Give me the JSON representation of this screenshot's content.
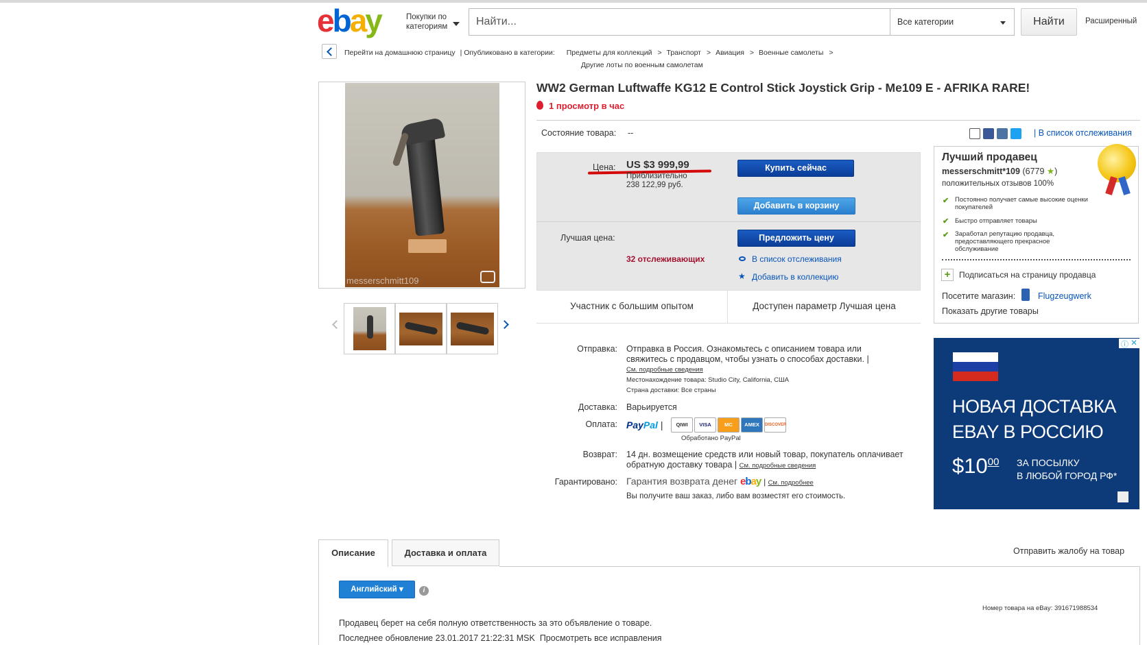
{
  "header": {
    "logo": "ebay",
    "categories_btn": "Покупки по категориям",
    "search_placeholder": "Найти...",
    "category_select": "Все категории",
    "search_button": "Найти",
    "advanced": "Расширенный"
  },
  "breadcrumb": {
    "home": "Перейти на домашнюю страницу",
    "published": "| Опубликовано в категории:",
    "items": [
      "Предметы для коллекций",
      "Транспорт",
      "Авиация",
      "Военные самолеты"
    ],
    "other": "Другие лоты по военным самолетам"
  },
  "gallery": {
    "watermark": "messerschmitt109"
  },
  "item": {
    "title": "WW2 German Luftwaffe KG12 E Control Stick Joystick Grip - Me109 E - AFRIKA RARE!",
    "views": "1 просмотр в час",
    "condition_label": "Состояние товара:",
    "condition_value": "--",
    "watchlist_top": "| В список отслеживания"
  },
  "price_box": {
    "price_label": "Цена:",
    "price": "US $3 999,99",
    "approx_line1": "Приблизительно",
    "approx_line2": "238 122,99 руб.",
    "buy_now": "Купить сейчас",
    "add_to_cart": "Добавить в корзину",
    "best_offer_label": "Лучшая цена:",
    "make_offer": "Предложить цену",
    "watchers": "32 отслеживающих",
    "add_watch": "В список отслеживания",
    "add_collection": "Добавить в коллекцию",
    "experienced": "Участник с большим опытом",
    "best_offer_available": "Доступен параметр Лучшая цена"
  },
  "seller": {
    "title": "Лучший продавец",
    "name": "messerschmitt*109",
    "feedback": "(6779",
    "feedback_end": ")",
    "positive": "положительных отзывов 100%",
    "features": [
      "Постоянно получает самые высокие оценки покупателей",
      "Быстро отправляет товары",
      "Заработал репутацию продавца, предоставляющего прекрасное обслуживание"
    ],
    "follow": "Подписаться на страницу продавца",
    "visit_label": "Посетите магазин:",
    "store": "Flugzeugwerk",
    "other_items": "Показать другие товары"
  },
  "shipping": {
    "ship_label": "Отправка:",
    "ship_text_1": "Отправка в Россия. Ознакомьтесь с описанием товара или",
    "ship_text_2": "свяжитесь с продавцом, чтобы узнать о способах доставки. |",
    "details_link": "См. подробные сведения",
    "location": "Местонахождение товара:  Studio City, California, США",
    "countries": "Страна доставки:  Все страны",
    "delivery_label": "Доставка:",
    "delivery_value": "Варьируется",
    "payment_label": "Оплата:",
    "paypal_a": "Pay",
    "paypal_b": "Pal",
    "processed": "Обработано PayPal",
    "cards": [
      "QIWI",
      "VISA",
      "MC",
      "AMEX",
      "DISCOVER"
    ],
    "returns_label": "Возврат:",
    "returns_1": "14 дн. возмещение средств или новый товар, покупатель оплачивает",
    "returns_2": "обратную доставку товара |",
    "returns_link": "См. подробные сведения",
    "guarantee_label": "Гарантировано:",
    "guarantee_text": "Гарантия возврата денег",
    "guarantee_link": "См. подробнее",
    "guarantee_note": "Вы получите ваш заказ, либо вам возместят его стоимость."
  },
  "ad": {
    "line1": "НОВАЯ ДОСТАВКА",
    "line2": "EBAY В РОССИЮ",
    "price": "$10",
    "cents": "00",
    "sub1": "ЗА ПОСЫЛКУ",
    "sub2": "В ЛЮБОЙ ГОРОД РФ*"
  },
  "tabs": {
    "description": "Описание",
    "shipping": "Доставка и оплата",
    "report": "Отправить жалобу на товар",
    "language": "Английский",
    "item_number": "Номер товара на eBay:  391671988534",
    "responsibility": "Продавец берет на себя полную ответственность за это объявление о товаре.",
    "last_update": "Последнее обновление  23.01.2017 21:22:31 MSK",
    "revisions": "Просмотреть все исправления"
  },
  "colors": {
    "link": "#0654ba",
    "accent_red": "#dd1e31",
    "button_blue": "#0b3d98"
  }
}
